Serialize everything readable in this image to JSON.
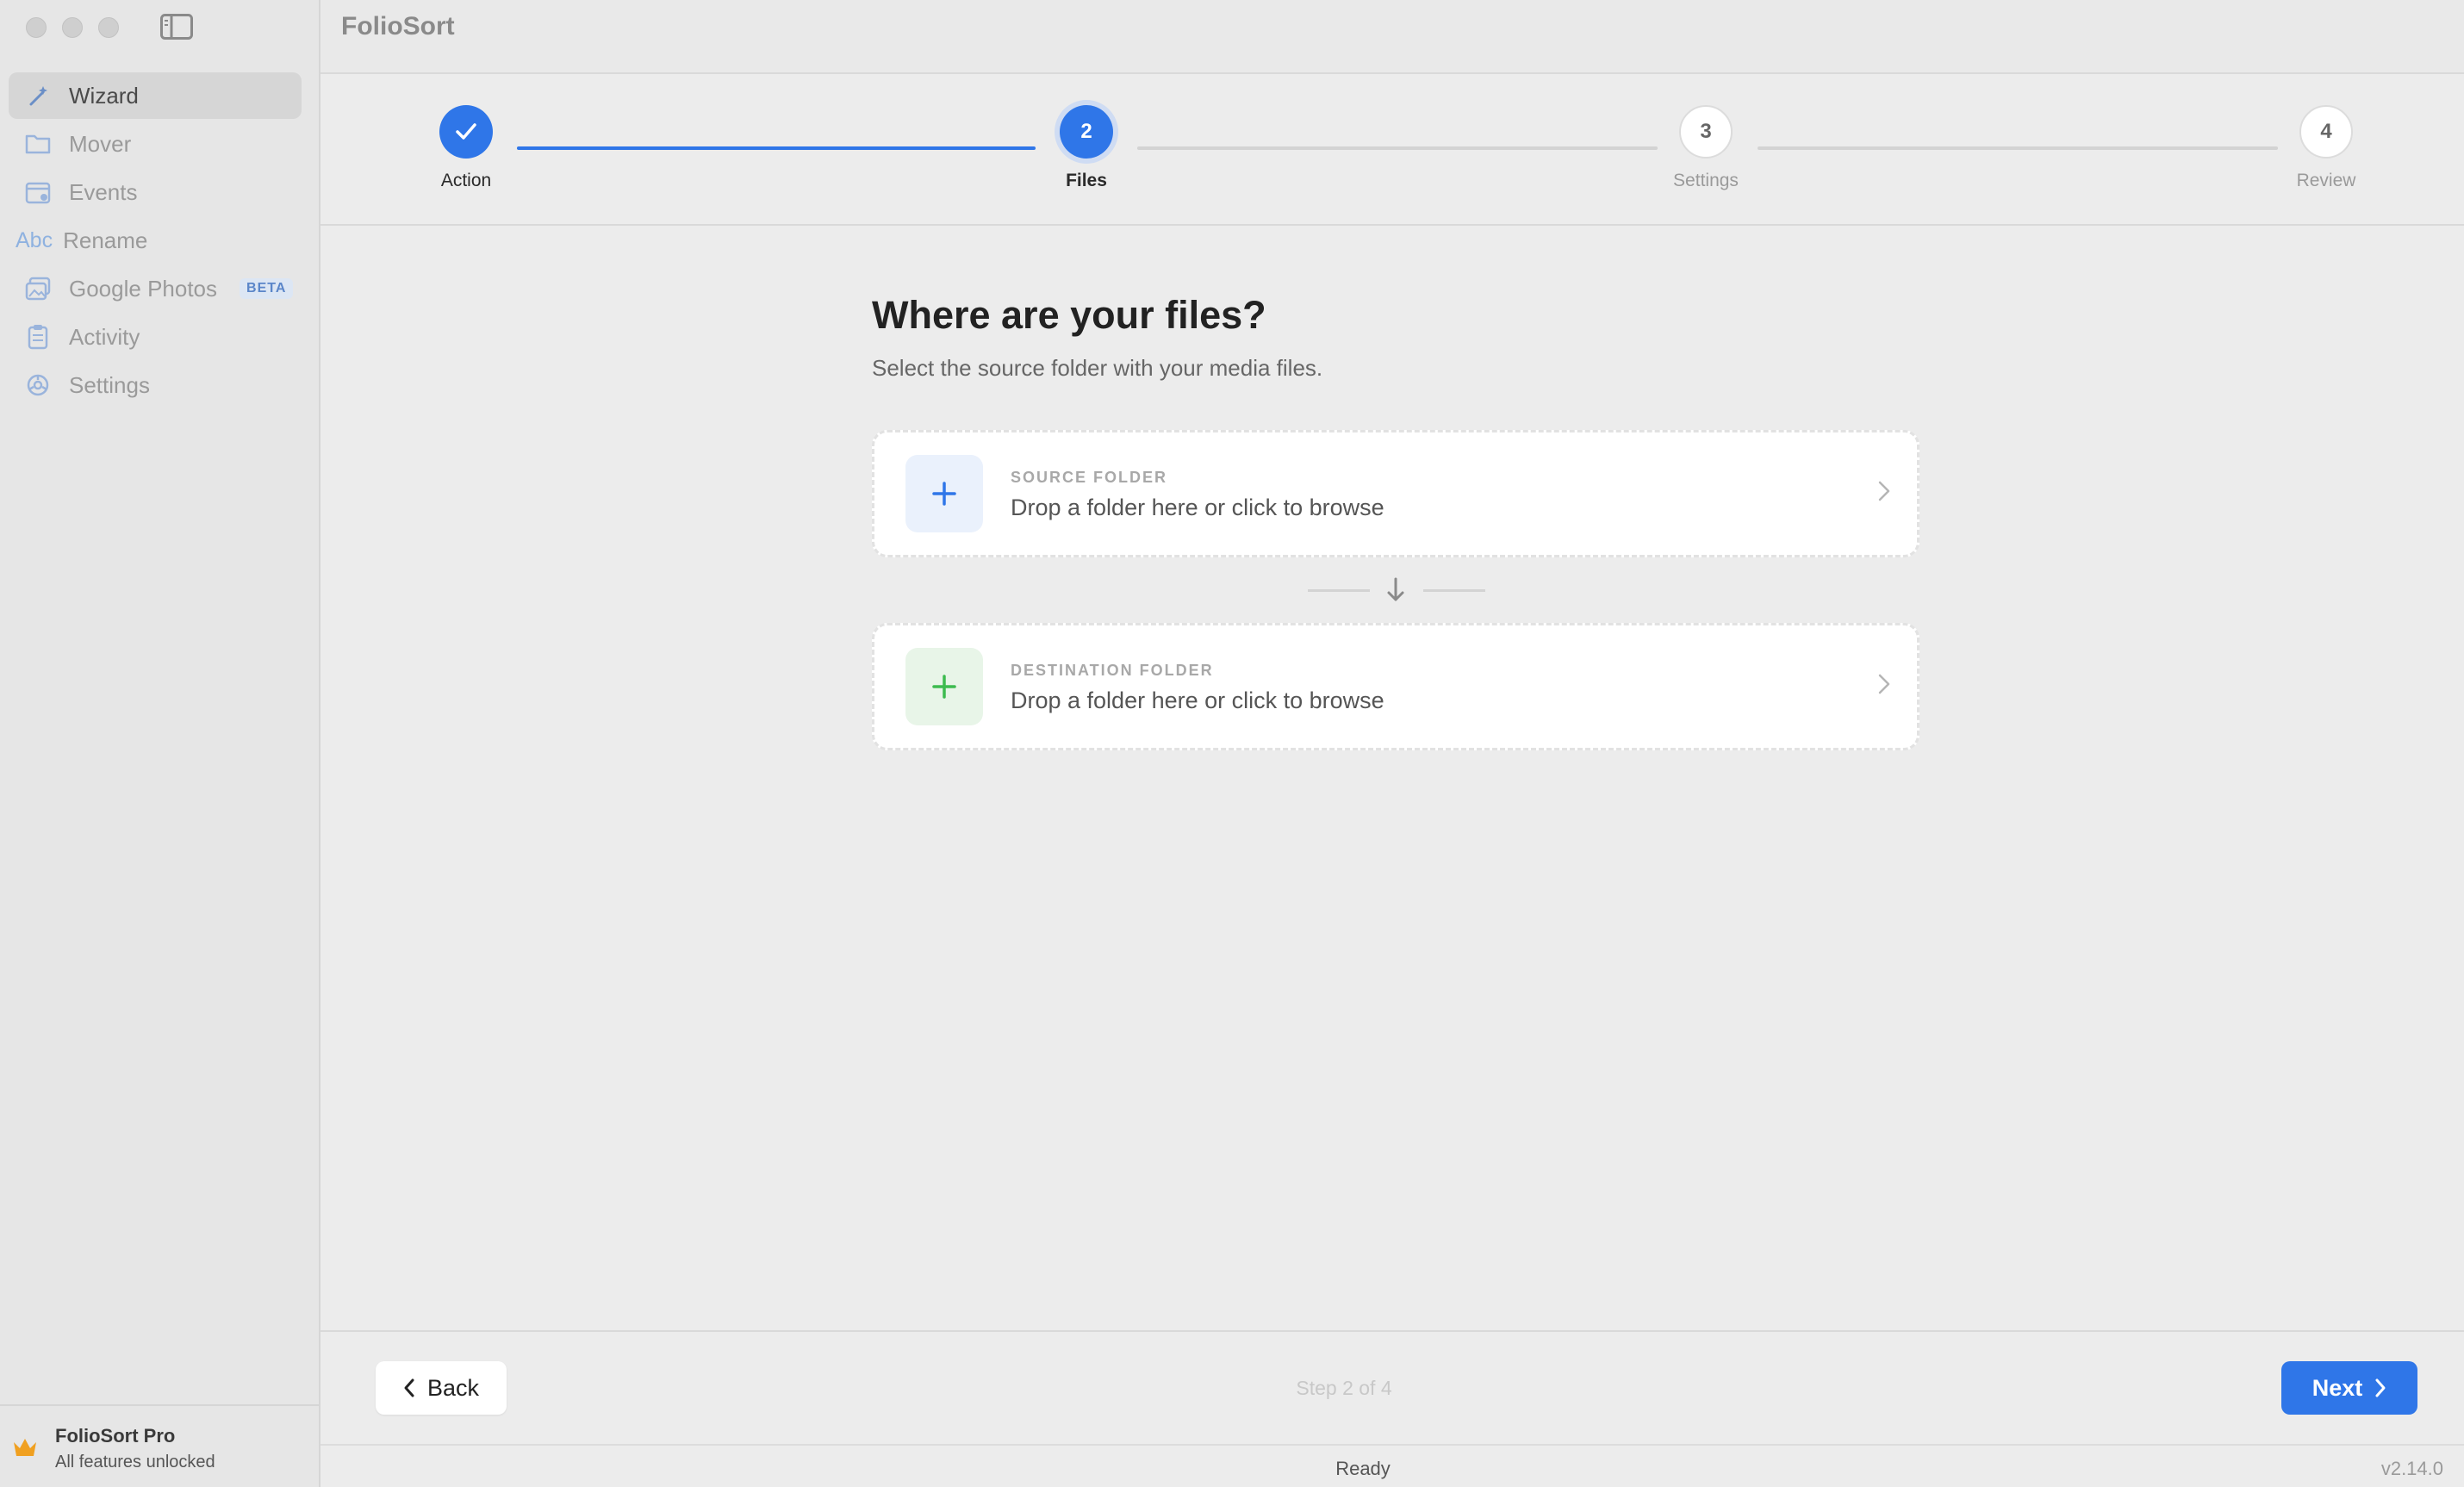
{
  "app": {
    "title": "FolioSort"
  },
  "sidebar": {
    "items": [
      {
        "label": "Wizard",
        "icon": "wand-icon",
        "active": true
      },
      {
        "label": "Mover",
        "icon": "folder-icon"
      },
      {
        "label": "Events",
        "icon": "calendar-icon"
      },
      {
        "label": "Rename",
        "icon": "abc-icon",
        "icon_text": "Abc"
      },
      {
        "label": "Google Photos",
        "icon": "photos-icon",
        "badge": "BETA"
      },
      {
        "label": "Activity",
        "icon": "clipboard-icon"
      },
      {
        "label": "Settings",
        "icon": "gear-icon"
      }
    ],
    "pro": {
      "title": "FolioSort Pro",
      "subtitle": "All features unlocked",
      "icon": "crown-icon"
    }
  },
  "stepper": {
    "steps": [
      {
        "number": "1",
        "label": "Action",
        "state": "done"
      },
      {
        "number": "2",
        "label": "Files",
        "state": "current"
      },
      {
        "number": "3",
        "label": "Settings",
        "state": "todo"
      },
      {
        "number": "4",
        "label": "Review",
        "state": "todo"
      }
    ]
  },
  "main": {
    "heading": "Where are your files?",
    "subtitle": "Select the source folder with your media files.",
    "source": {
      "caption": "SOURCE FOLDER",
      "text": "Drop a folder here or click to browse"
    },
    "destination": {
      "caption": "DESTINATION FOLDER",
      "text": "Drop a folder here or click to browse"
    }
  },
  "footer": {
    "back_label": "Back",
    "step_text": "Step 2 of 4",
    "next_label": "Next"
  },
  "status": {
    "text": "Ready",
    "version": "v2.14.0"
  },
  "colors": {
    "accent": "#2f76e8",
    "green": "#3dbb4f",
    "badge": "#5b86c9"
  }
}
